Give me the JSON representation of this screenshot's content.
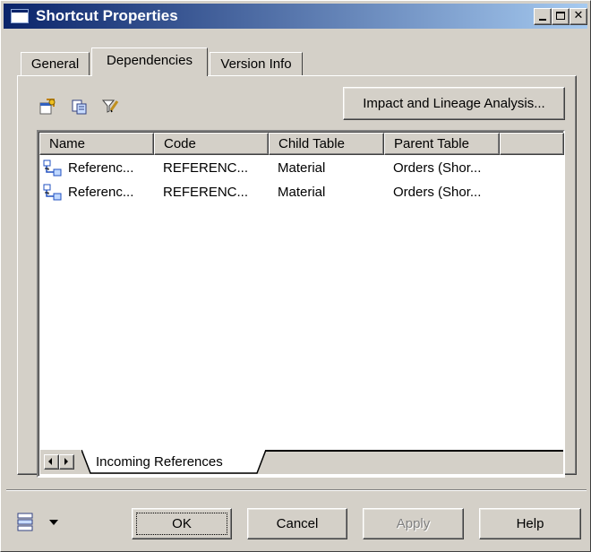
{
  "window": {
    "title": "Shortcut Properties"
  },
  "tabs": [
    {
      "label": "General"
    },
    {
      "label": "Dependencies"
    },
    {
      "label": "Version Info"
    }
  ],
  "toolbar": {
    "icons": [
      "properties-icon",
      "copy-icon",
      "filter-icon"
    ],
    "impact_button_label": "Impact and Lineage Analysis..."
  },
  "list": {
    "columns": [
      "Name",
      "Code",
      "Child Table",
      "Parent Table"
    ],
    "rows": [
      {
        "name": "Referenc...",
        "code": "REFERENC...",
        "child_table": "Material",
        "parent_table": "Orders (Shor..."
      },
      {
        "name": "Referenc...",
        "code": "REFERENC...",
        "child_table": "Material",
        "parent_table": "Orders (Shor..."
      }
    ],
    "sheet_tab": "Incoming References"
  },
  "buttons": {
    "ok": "OK",
    "cancel": "Cancel",
    "apply": "Apply",
    "help": "Help"
  },
  "colors": {
    "face": "#d4d0c8",
    "titlebar_start": "#0a246a",
    "titlebar_end": "#a6caf0"
  }
}
